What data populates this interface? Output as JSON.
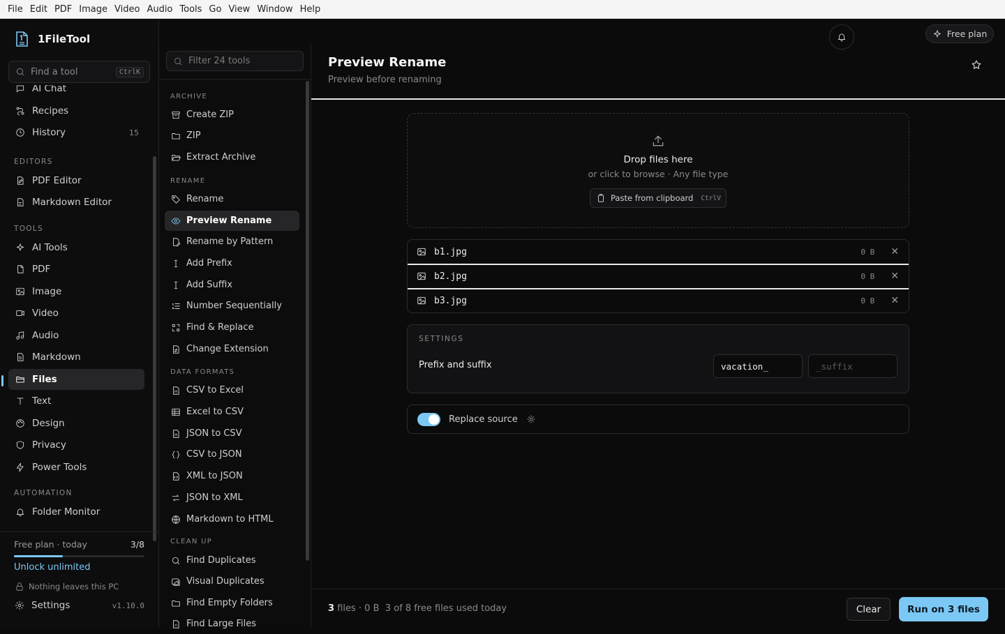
{
  "menubar": [
    "File",
    "Edit",
    "PDF",
    "Image",
    "Video",
    "Audio",
    "Tools",
    "Go",
    "View",
    "Window",
    "Help"
  ],
  "app": {
    "name": "1FileTool"
  },
  "find": {
    "placeholder": "Find a tool",
    "shortcut": "CtrlK"
  },
  "nav": {
    "top_items": [
      {
        "label": "AI Chat",
        "icon": "chat-icon"
      },
      {
        "label": "Recipes",
        "icon": "recipes-icon"
      },
      {
        "label": "History",
        "icon": "history-icon",
        "count": "15"
      }
    ],
    "editors_label": "EDITORS",
    "editors": [
      {
        "label": "PDF Editor",
        "icon": "pdf-editor-icon"
      },
      {
        "label": "Markdown Editor",
        "icon": "markdown-editor-icon"
      }
    ],
    "tools_label": "TOOLS",
    "tools": [
      {
        "label": "AI Tools",
        "icon": "sparkle-icon"
      },
      {
        "label": "PDF",
        "icon": "pdf-icon"
      },
      {
        "label": "Image",
        "icon": "image-icon"
      },
      {
        "label": "Video",
        "icon": "video-icon"
      },
      {
        "label": "Audio",
        "icon": "music-icon"
      },
      {
        "label": "Markdown",
        "icon": "markdown-icon"
      },
      {
        "label": "Files",
        "icon": "folder-icon",
        "active": true
      },
      {
        "label": "Text",
        "icon": "text-icon"
      },
      {
        "label": "Design",
        "icon": "palette-icon"
      },
      {
        "label": "Privacy",
        "icon": "shield-icon"
      },
      {
        "label": "Power Tools",
        "icon": "bolt-icon"
      }
    ],
    "automation_label": "AUTOMATION",
    "automation": [
      {
        "label": "Folder Monitor",
        "icon": "bell-icon"
      }
    ]
  },
  "plan": {
    "label": "Free plan · today",
    "usage": "3/8",
    "usage_fraction": 0.375,
    "unlock": "Unlock unlimited",
    "privacy": "Nothing leaves this PC"
  },
  "settings": {
    "label": "Settings",
    "version": "v1.10.0"
  },
  "toolpanel": {
    "filter_placeholder": "Filter 24 tools",
    "sections": {
      "archive": "ARCHIVE",
      "rename": "RENAME",
      "data_formats": "DATA FORMATS",
      "clean_up": "CLEAN UP"
    },
    "archive": [
      "Create ZIP",
      "ZIP",
      "Extract Archive"
    ],
    "rename": [
      "Rename",
      "Preview Rename",
      "Rename by Pattern",
      "Add Prefix",
      "Add Suffix",
      "Number Sequentially",
      "Find & Replace",
      "Change Extension"
    ],
    "data_formats": [
      "CSV to Excel",
      "Excel to CSV",
      "JSON to CSV",
      "CSV to JSON",
      "XML to JSON",
      "JSON to XML",
      "Markdown to HTML"
    ],
    "clean_up": [
      "Find Duplicates",
      "Visual Duplicates",
      "Find Empty Folders",
      "Find Large Files"
    ]
  },
  "header": {
    "free_plan": "Free plan",
    "title": "Preview Rename",
    "subtitle": "Preview before renaming"
  },
  "dropzone": {
    "title": "Drop files here",
    "subtitle": "or click to browse · Any file type",
    "paste": "Paste from clipboard",
    "paste_shortcut": "CtrlV"
  },
  "files": [
    {
      "name": "b1.jpg",
      "size": "0 B"
    },
    {
      "name": "b2.jpg",
      "size": "0 B"
    },
    {
      "name": "b3.jpg",
      "size": "0 B"
    }
  ],
  "settings_panel": {
    "heading": "SETTINGS",
    "label": "Prefix and suffix",
    "prefix_value": "vacation_",
    "suffix_placeholder": "_suffix"
  },
  "replace": {
    "label": "Replace source",
    "enabled": true
  },
  "footer": {
    "count": "3",
    "files_word": "files",
    "size": "· 0 B",
    "usage": "3 of 8 free files used today",
    "clear": "Clear",
    "run": "Run on 3 files"
  },
  "colors": {
    "accent": "#7cc8f5",
    "background": "#0b0b0c"
  }
}
